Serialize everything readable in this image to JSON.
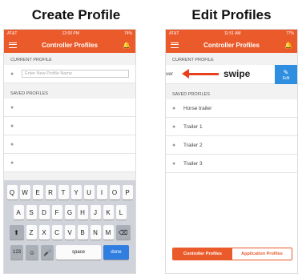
{
  "headings": {
    "left": "Create Profile",
    "right": "Edit Profiles"
  },
  "left_phone": {
    "status": {
      "carrier": "AT&T",
      "time": "12:00 PM",
      "battery": "74%"
    },
    "nav_title": "Controller Profiles",
    "current_label": "CURRENT PROFILE",
    "input_placeholder": "Enter New Profile Name",
    "saved_label": "SAVED PROFILES",
    "keyboard": {
      "row1": [
        "Q",
        "W",
        "E",
        "R",
        "T",
        "Y",
        "U",
        "I",
        "O",
        "P"
      ],
      "row2": [
        "A",
        "S",
        "D",
        "F",
        "G",
        "H",
        "J",
        "K",
        "L"
      ],
      "row3": [
        "Z",
        "X",
        "C",
        "V",
        "B",
        "N",
        "M"
      ],
      "num_label": "123",
      "space_label": "space",
      "done_label": "done"
    }
  },
  "right_phone": {
    "status": {
      "carrier": "AT&T",
      "time": "11:51 AM",
      "battery": "77%"
    },
    "nav_title": "Controller Profiles",
    "current_label": "CURRENT PROFILE",
    "current_partial": "ver",
    "swipe_label": "swipe",
    "edit_label": "Edit",
    "saved_label": "SAVED PROFILES",
    "saved_items": [
      "Horse trailer",
      "Trailer 1",
      "Trailer 2",
      "Trailer 3"
    ],
    "tabs": {
      "active": "Controller Profiles",
      "inactive": "Application Profiles"
    }
  },
  "colors": {
    "accent": "#ea5a2a",
    "edit_blue": "#2f8ee0",
    "arrow_red": "#e8401d"
  }
}
